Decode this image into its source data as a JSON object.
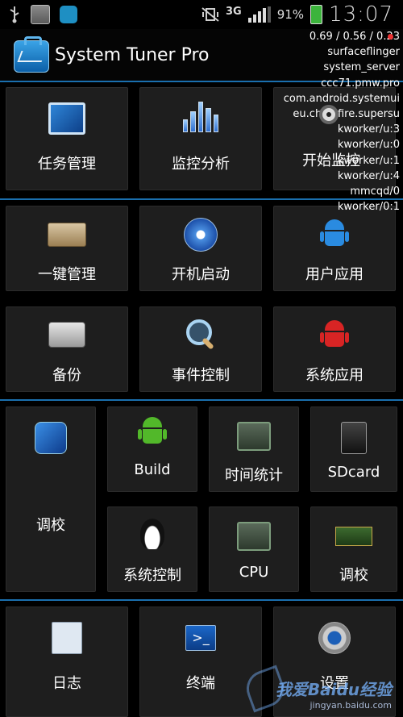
{
  "status_bar": {
    "network": "3G",
    "battery": "91%",
    "time": "13:07"
  },
  "header": {
    "title": "System Tuner Pro"
  },
  "overlay": {
    "lines": [
      "0.69 / 0.56 / 0.23",
      "surfaceflinger",
      "system_server",
      "ccc71.pmw.pro",
      "com.android.systemui",
      "eu.chainfire.supersu",
      "kworker/u:3",
      "kworker/u:0",
      "kworker/u:1",
      "kworker/u:4",
      "mmcqd/0",
      "kworker/0:1"
    ]
  },
  "tiles": {
    "task_manager": "任务管理",
    "monitor_analysis": "监控分析",
    "start_monitor": "开始监控",
    "one_key_manage": "一键管理",
    "boot_startup": "开机启动",
    "user_apps": "用户应用",
    "backup": "备份",
    "event_control": "事件控制",
    "system_apps": "系统应用",
    "tuning_large": "调校",
    "build": "Build",
    "time_stats": "时间统计",
    "sdcard": "SDcard",
    "system_control": "系统控制",
    "cpu": "CPU",
    "tuning_small": "调校",
    "log": "日志",
    "terminal": "终端",
    "settings": "设置"
  },
  "watermark": {
    "text": "我爱Baidu经验",
    "url": "jingyan.baidu.com"
  }
}
